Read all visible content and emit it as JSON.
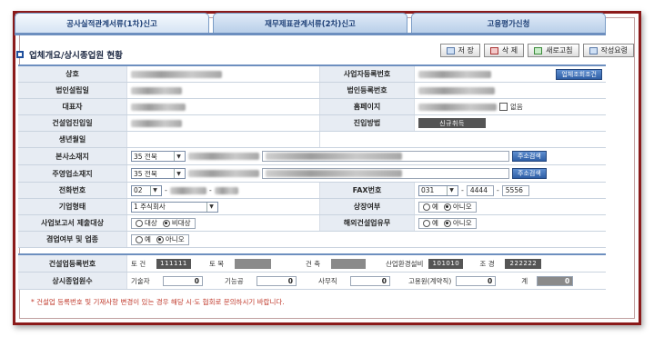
{
  "tabs": [
    {
      "label": "공사실적관계서류(1차)신고"
    },
    {
      "label": "재무제표관계서류(2차)신고"
    },
    {
      "label": "고용평가신청"
    }
  ],
  "section": {
    "title": "업체개요/상시종업원 현황"
  },
  "toolbar": {
    "save": "저 장",
    "delete": "삭 제",
    "refresh": "새로고침",
    "guide": "작성요령"
  },
  "form": {
    "company_name": "상호",
    "biz_reg_no": "사업자등록번호",
    "btn_biz_reg_lookup": "업체조회조건",
    "corp_est_date": "법인설립일",
    "corp_reg_no": "법인등록번호",
    "ceo": "대표자",
    "homepage": "홈페이지",
    "homepage_none": "없음",
    "construction_entry": "건설업진입일",
    "entry_method": "진입방법",
    "entry_method_value": "신규취득",
    "birth_date": "생년월일",
    "hq_address": "본사소재지",
    "hq_region": "35 전북",
    "btn_address_search_1": "주소검색",
    "main_office": "주영업소재지",
    "main_region": "35 전북",
    "btn_address_search_2": "주소검색",
    "phone": "전화번호",
    "phone_area": "02",
    "fax": "FAX번호",
    "fax_area": "031",
    "fax_mid": "4444",
    "fax_last": "5556",
    "company_type": "기업형태",
    "company_type_value": "1 주식회사",
    "listed": "상장여부",
    "opt_yes": "예",
    "opt_no": "아니오",
    "biz_report": "사업보고서 제출대상",
    "opt_target": "대상",
    "opt_non_target": "비대상",
    "overseas": "해외건설업유무",
    "concurrent": "겸업여부 및 업종"
  },
  "registry": {
    "label": "건설업등록번호",
    "civil": "토 건",
    "civil_no": "111111",
    "earthwork": "토 목",
    "building": "건 축",
    "industrial": "산업환경설비",
    "industrial_no": "101010",
    "landscape": "조 경",
    "landscape_no": "222222"
  },
  "staff": {
    "label": "상시종업원수",
    "technician": "기술자",
    "technician_n": "0",
    "skilled": "기능공",
    "skilled_n": "0",
    "office": "사무직",
    "office_n": "0",
    "contract": "고용원(계약직)",
    "contract_n": "0",
    "total": "계",
    "total_n": "0"
  },
  "notice": "* 건설업 등록번호 및 기재사항 변경이 있는 경우 해당 시·도 협회로 문의하시기 바랍니다."
}
